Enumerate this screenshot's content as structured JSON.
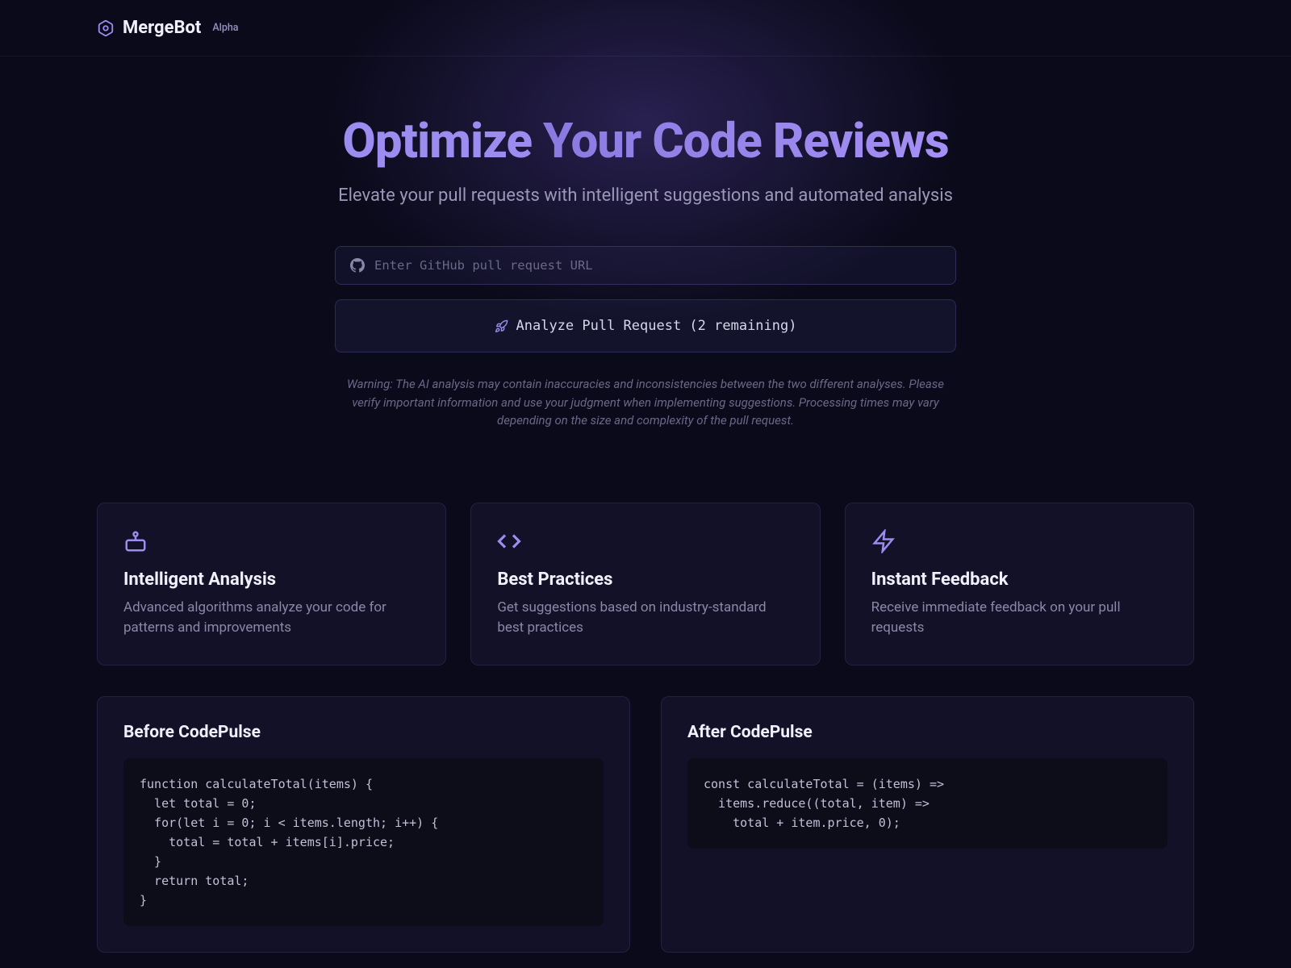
{
  "header": {
    "brand": "MergeBot",
    "badge": "Alpha"
  },
  "hero": {
    "title_plain": "Optimize ",
    "title_accent": "Your Code Reviews",
    "subtitle": "Elevate your pull requests with intelligent suggestions and automated analysis"
  },
  "input": {
    "placeholder": "Enter GitHub pull request URL",
    "button": "Analyze Pull Request (2 remaining)"
  },
  "warning": "Warning: The AI analysis may contain inaccuracies and inconsistencies between the two different analyses. Please verify important information and use your judgment when implementing suggestions. Processing times may vary depending on the size and complexity of the pull request.",
  "features": [
    {
      "title": "Intelligent Analysis",
      "desc": "Advanced algorithms analyze your code for patterns and improvements"
    },
    {
      "title": "Best Practices",
      "desc": "Get suggestions based on industry-standard best practices"
    },
    {
      "title": "Instant Feedback",
      "desc": "Receive immediate feedback on your pull requests"
    }
  ],
  "compare": {
    "before_title": "Before CodePulse",
    "before_code": "function calculateTotal(items) {\n  let total = 0;\n  for(let i = 0; i < items.length; i++) {\n    total = total + items[i].price;\n  }\n  return total;\n}",
    "after_title": "After CodePulse",
    "after_code": "const calculateTotal = (items) =>\n  items.reduce((total, item) =>\n    total + item.price, 0);"
  }
}
